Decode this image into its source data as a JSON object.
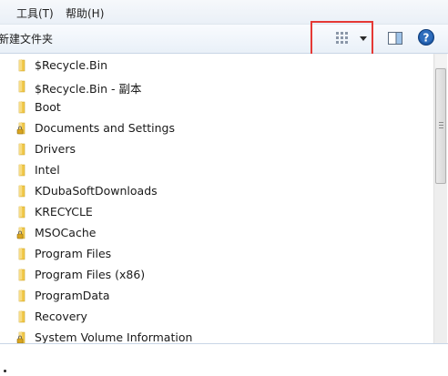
{
  "menubar": {
    "cut_label": "’",
    "tools": "工具(T)",
    "help": "帮助(H)"
  },
  "toolbar": {
    "new_folder": "新建文件夹",
    "view_icon": "large-icons-view-icon",
    "arrow_icon": "dropdown-arrow-icon",
    "preview_icon": "preview-pane-icon",
    "help_icon": "help-icon"
  },
  "colors": {
    "highlight": "#e53935",
    "folder": "#f2c94c",
    "help_blue": "#1e5aa8"
  },
  "files": [
    {
      "name": "$Recycle.Bin",
      "locked": false
    },
    {
      "name": "$Recycle.Bin - 副本",
      "locked": false
    },
    {
      "name": "Boot",
      "locked": false
    },
    {
      "name": "Documents and Settings",
      "locked": true
    },
    {
      "name": "Drivers",
      "locked": false
    },
    {
      "name": "Intel",
      "locked": false
    },
    {
      "name": "KDubaSoftDownloads",
      "locked": false
    },
    {
      "name": "KRECYCLE",
      "locked": false
    },
    {
      "name": "MSOCache",
      "locked": true
    },
    {
      "name": "Program Files",
      "locked": false
    },
    {
      "name": "Program Files (x86)",
      "locked": false
    },
    {
      "name": "ProgramData",
      "locked": false
    },
    {
      "name": "Recovery",
      "locked": false
    },
    {
      "name": "System Volume Information",
      "locked": true
    }
  ]
}
